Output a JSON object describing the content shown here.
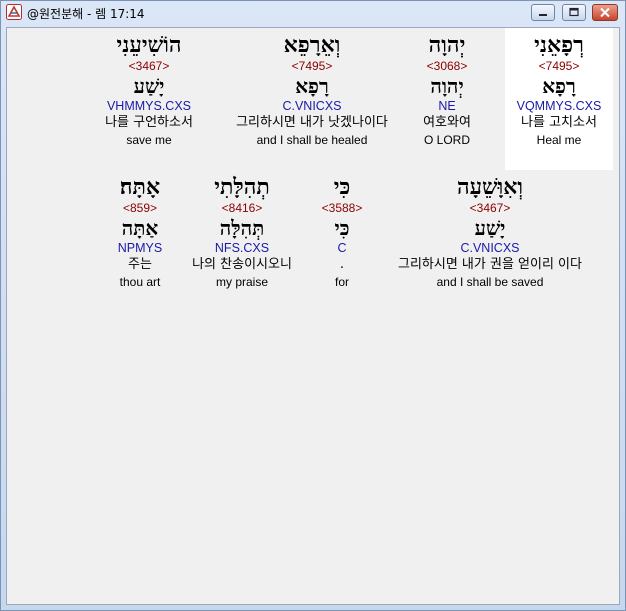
{
  "window": {
    "title": "@원전분해 - 렘 17:14",
    "colors": {
      "hebrew": "#000000",
      "strongs": "#8b0000",
      "grammar": "#1a1aa8",
      "selected_bg": "#ffffff"
    }
  },
  "rows": [
    {
      "words": [
        {
          "hebrew": "רְפָאֵנִי",
          "strongs": "<7495>",
          "lemma": "רָפָא",
          "grammar": "VQMMYS.CXS",
          "korean": "나를 고치소서",
          "english": "Heal me",
          "selected": true
        },
        {
          "hebrew": "יְהוָה",
          "strongs": "<3068>",
          "lemma": "יְהוָה",
          "grammar": "NE",
          "korean": "여호와여",
          "english": "O LORD"
        },
        {
          "hebrew": "וְאֵרָפֵא",
          "strongs": "<7495>",
          "lemma": "רָפָא",
          "grammar": "C.VNICXS",
          "korean": "그리하시면 내가 낫겠나이다",
          "english": "and I shall be healed"
        },
        {
          "hebrew": "הוֹשִׁיעֵנִי",
          "strongs": "<3467>",
          "lemma": "יָשַׁע",
          "grammar": "VHMMYS.CXS",
          "korean": "나를 구언하소서",
          "english": "save me"
        }
      ]
    },
    {
      "words": [
        {
          "hebrew": "וְאִוָּשֵׁעָה",
          "strongs": "<3467>",
          "lemma": "יָשַׁע",
          "grammar": "C.VNICXS",
          "korean": "그리하시면 내가 권을 얻이리 이다",
          "english": "and I shall be saved"
        },
        {
          "hebrew": "כִּי",
          "strongs": "<3588>",
          "lemma": "כִּי",
          "grammar": "C",
          "korean": ".",
          "english": "for"
        },
        {
          "hebrew": "תְהִלָּתִי",
          "strongs": "<8416>",
          "lemma": "תְּהִלָּה",
          "grammar": "NFS.CXS",
          "korean": "나의 찬송이시오니",
          "english": "my praise"
        },
        {
          "hebrew": "אָתָּה׃",
          "strongs": "<859>",
          "lemma": "אַתָּה",
          "grammar": "NPMYS",
          "korean": "주는",
          "english": "thou art"
        }
      ]
    }
  ]
}
